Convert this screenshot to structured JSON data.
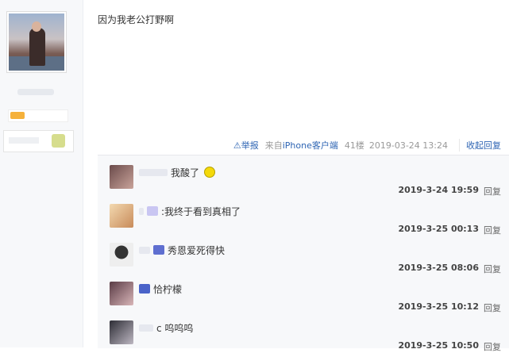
{
  "post": {
    "text": "因为我老公打野啊"
  },
  "meta": {
    "report_icon": "warning-icon",
    "report_label": "举报",
    "source_prefix": "来自",
    "source_link": "iPhone客户端",
    "floor": "41楼",
    "time": "2019-03-24 13:24",
    "collapse_label": "收起回复"
  },
  "replies": [
    {
      "text": "我酸了",
      "time": "2019-3-24 19:59",
      "reply_label": "回复",
      "emoji": "lemon-icon"
    },
    {
      "text": ":我终于看到真相了",
      "time": "2019-3-25 00:13",
      "reply_label": "回复"
    },
    {
      "text": "秀恩爱死得快",
      "time": "2019-3-25 08:06",
      "reply_label": "回复"
    },
    {
      "text": "恰柠檬",
      "time": "2019-3-25 10:12",
      "reply_label": "回复"
    },
    {
      "text": "c 呜呜呜",
      "time": "2019-3-25 10:50",
      "reply_label": "回复"
    }
  ],
  "colors": {
    "link": "#2d64b3",
    "panel_bg": "#f7f8fa"
  }
}
